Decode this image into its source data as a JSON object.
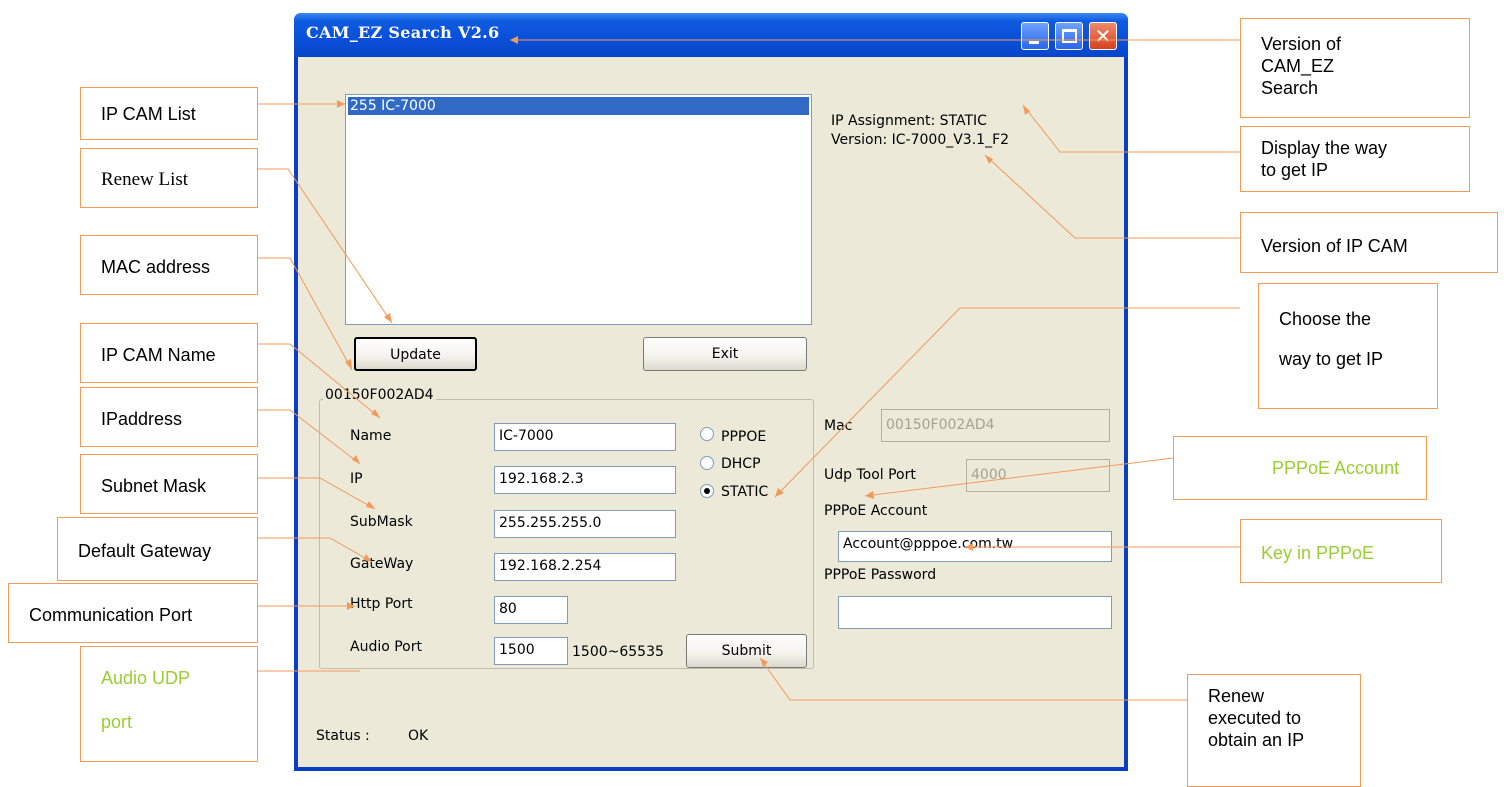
{
  "window": {
    "title": "CAM_EZ Search V2.6"
  },
  "device_list": {
    "items": [
      "255 IC-7000"
    ],
    "selected_index": 0
  },
  "info": {
    "ip_assignment": "IP Assignment:  STATIC",
    "version": "Version: IC-7000_V3.1_F2"
  },
  "buttons": {
    "update": "Update",
    "exit": "Exit",
    "submit": "Submit"
  },
  "group_title": "00150F002AD4",
  "form": {
    "name_label": "Name",
    "name_value": "IC-7000",
    "ip_label": "IP",
    "ip_value": "192.168.2.3",
    "submask_label": "SubMask",
    "submask_value": "255.255.255.0",
    "gateway_label": "GateWay",
    "gateway_value": "192.168.2.254",
    "http_port_label": "Http Port",
    "http_port_value": "80",
    "audio_port_label": "Audio Port",
    "audio_port_value": "1500",
    "audio_port_range": "1500~65535"
  },
  "ip_mode": {
    "options": [
      "PPPOE",
      "DHCP",
      "STATIC"
    ],
    "selected": "STATIC"
  },
  "right_panel": {
    "mac_label": "Mac",
    "mac_value": "00150F002AD4",
    "udp_label": "Udp Tool Port",
    "udp_value": "4000",
    "pppoe_account_label": "PPPoE Account",
    "pppoe_account_value": "Account@pppoe.com.tw",
    "pppoe_password_label": "PPPoE Password",
    "pppoe_password_value": ""
  },
  "status": {
    "label": "Status :",
    "value": "OK"
  },
  "annotations": {
    "ip_cam_list": "IP CAM List",
    "renew_list": "Renew List",
    "mac_address": "MAC address",
    "ip_cam_name": "IP CAM Name",
    "ipaddress": "IPaddress",
    "subnet_mask": "Subnet Mask",
    "default_gateway": "Default Gateway",
    "communication_port": "Communication Port",
    "audio_udp_line1": "Audio UDP",
    "audio_udp_line2": "port",
    "version_ez_1": "Version of",
    "version_ez_2": "CAM_EZ",
    "version_ez_3": "Search",
    "display_way_1": "Display the way",
    "display_way_2": "to get IP",
    "version_cam": "Version of IP CAM",
    "choose_way_1": "Choose the",
    "choose_way_2": "way to get IP",
    "pppoe_account": "PPPoE Account",
    "key_in_pppoe": "Key in PPPoE",
    "renew_exec_1": "Renew",
    "renew_exec_2": "executed to",
    "renew_exec_3": "obtain an IP"
  },
  "colors": {
    "title_bar": "#0a4fd8",
    "window_face": "#ece9d8",
    "selection": "#316ac5",
    "annotation_border": "#f29a5a",
    "annotation_green": "#9acd32"
  }
}
